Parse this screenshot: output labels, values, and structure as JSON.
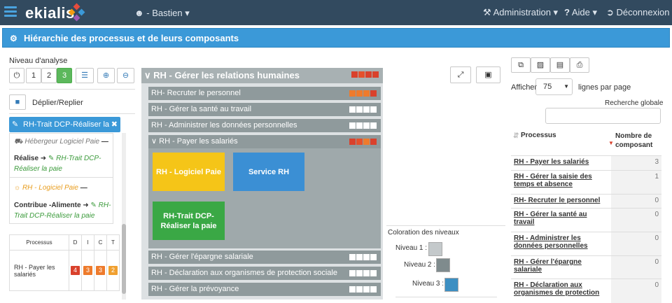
{
  "topbar": {
    "logo": "ekialis",
    "user": "Bastien",
    "admin": "Administration",
    "help": "Aide",
    "logout": "Déconnexion"
  },
  "header": {
    "title": "Hiérarchie des processus et de leurs composants"
  },
  "left": {
    "level_label": "Niveau d'analyse",
    "levels": [
      "1",
      "2",
      "3"
    ],
    "expand_label": "Déplier/Replier",
    "selected_tag": "RH-Trait DCP-Réaliser la paie",
    "card1_host": "Hébergeur Logiciel Paie",
    "card1_rel": "Réalise",
    "card1_target": "RH-Trait DCP-Réaliser la paie",
    "card2_host": "RH - Logiciel Paie",
    "card2_rel": "Contribue -Alimente",
    "card2_target": "RH-Trait DCP-Réaliser la paie",
    "table": {
      "headers": [
        "Processus",
        "D",
        "I",
        "C",
        "T"
      ],
      "row": {
        "name": "RH - Payer les salariés",
        "values": [
          "4",
          "3",
          "3",
          "2"
        ]
      }
    }
  },
  "middle": {
    "main_title": "RH - Gérer les relations humaines",
    "rows": [
      "RH- Recruter le personnel",
      "RH - Gérer la santé au travail",
      "RH - Administrer les données personnelles"
    ],
    "open_row": "RH - Payer les salariés",
    "tiles": [
      "RH - Logiciel Paie",
      "Service RH",
      "RH-Trait DCP-Réaliser la paie"
    ],
    "rows_after": [
      "RH - Gérer l'épargne salariale",
      "RH - Déclaration aux organismes de protection sociale",
      "RH - Gérer la prévoyance"
    ]
  },
  "legend": {
    "title": "Coloration des niveaux",
    "l1": "Niveau 1 :",
    "l2": "Niveau 2 :",
    "l3": "Niveau 3 :",
    "c1": "#c4c9cb",
    "c2": "#7f8b8d",
    "c3": "#3d8fc2"
  },
  "right": {
    "show_label": "Afficher",
    "page_size": "75",
    "per_page": "lignes par page",
    "search_label": "Recherche globale",
    "col_process": "Processus",
    "col_count": "Nombre de composant",
    "rows": [
      {
        "name": "RH - Payer les salariés",
        "count": "3"
      },
      {
        "name": "RH - Gérer la saisie des temps et absence",
        "count": "1"
      },
      {
        "name": "RH- Recruter le personnel",
        "count": "0"
      },
      {
        "name": "RH - Gérer la santé au travail",
        "count": "0"
      },
      {
        "name": "RH - Administrer les données personnelles",
        "count": "0"
      },
      {
        "name": "RH - Gérer l'épargne salariale",
        "count": "0"
      },
      {
        "name": "RH - Déclaration aux organismes de protection",
        "count": "0"
      }
    ]
  }
}
